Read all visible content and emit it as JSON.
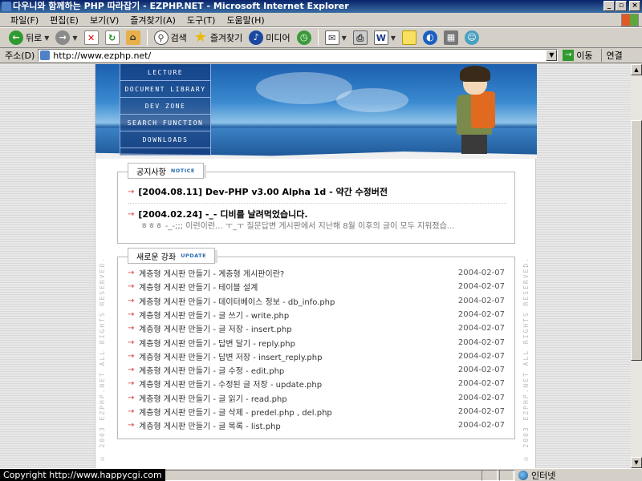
{
  "window": {
    "title": "다우니와 함께하는 PHP 따라잡기 - EZPHP.NET - Microsoft Internet Explorer"
  },
  "menubar": {
    "items": [
      "파일(F)",
      "편집(E)",
      "보기(V)",
      "즐겨찾기(A)",
      "도구(T)",
      "도움말(H)"
    ]
  },
  "toolbar": {
    "back_label": "뒤로",
    "search_label": "검색",
    "favorites_label": "즐겨찾기",
    "media_label": "미디어"
  },
  "address": {
    "label": "주소(D)",
    "url": "http://www.ezphp.net/",
    "go_label": "이동",
    "links_label": "연결"
  },
  "site": {
    "nav": [
      "LECTURE",
      "DOCUMENT LIBRARY",
      "DEV ZONE",
      "SEARCH FUNCTION",
      "DOWNLOADS"
    ],
    "side_text": "© 2003 EZPHP.NET ALL RIGHTS RESERVED."
  },
  "notice": {
    "header": "공지사항",
    "header_en": "NOTICE",
    "items": [
      {
        "title": "[2004.08.11] Dev-PHP v3.00 Alpha 1d - 약간 수정버전",
        "summary": ""
      },
      {
        "title": "[2004.02.24] -_- 디비를 날려먹었습니다.",
        "summary": "ㅎㅎㅎ -_-;;; 이런이런... ㅜ_ㅜ 질문답변 게시판에서 지난해 8월 이후의 글이 모두 지워졌습..."
      }
    ]
  },
  "update": {
    "header": "새로운 강좌",
    "header_en": "UPDATE",
    "rows": [
      {
        "title": "계층형 게시판 만들기 - 계층형 게시판이란?",
        "date": "2004-02-07"
      },
      {
        "title": "계층형 게시판 만들기 - 테이블 설계",
        "date": "2004-02-07"
      },
      {
        "title": "계층형 게시판 만들기 - 데이터베이스 정보 - db_info.php",
        "date": "2004-02-07"
      },
      {
        "title": "계층형 게시판 만들기 - 글 쓰기 - write.php",
        "date": "2004-02-07"
      },
      {
        "title": "계층형 게시판 만들기 - 글 저장 - insert.php",
        "date": "2004-02-07"
      },
      {
        "title": "계층형 게시판 만들기 - 답변 달기 - reply.php",
        "date": "2004-02-07"
      },
      {
        "title": "계층형 게시판 만들기 - 답변 저장 - insert_reply.php",
        "date": "2004-02-07"
      },
      {
        "title": "계층형 게시판 만들기 - 글 수정 - edit.php",
        "date": "2004-02-07"
      },
      {
        "title": "계층형 게시판 만들기 - 수정된 글 저장 - update.php",
        "date": "2004-02-07"
      },
      {
        "title": "계층형 게시판 만들기 - 글 읽기 - read.php",
        "date": "2004-02-07"
      },
      {
        "title": "계층형 게시판 만들기 - 글 삭제 - predel.php , del.php",
        "date": "2004-02-07"
      },
      {
        "title": "계층형 게시판 만들기 - 글 목록 - list.php",
        "date": "2004-02-07"
      }
    ]
  },
  "status": {
    "copyright": "Copyright  http://www.happycgi.com",
    "zone": "인터넷"
  },
  "colors": {
    "accent_arrow": "#d43a3a",
    "title_bar": "#0a246a",
    "tag_blue": "#2a6ab0"
  }
}
